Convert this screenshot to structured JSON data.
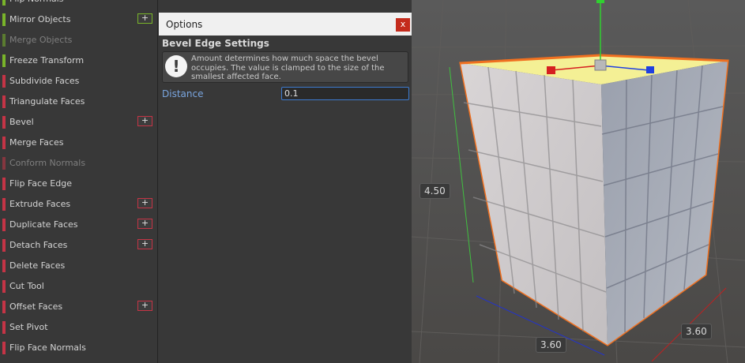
{
  "toolbar": {
    "items": [
      {
        "label": "Flip Normals",
        "color": "#79b42a",
        "has_plus": false,
        "disabled": false
      },
      {
        "label": "Mirror Objects",
        "color": "#79b42a",
        "has_plus": true,
        "disabled": false
      },
      {
        "label": "Merge Objects",
        "color": "#79b42a",
        "has_plus": false,
        "disabled": true
      },
      {
        "label": "Freeze Transform",
        "color": "#79b42a",
        "has_plus": false,
        "disabled": false
      },
      {
        "label": "Subdivide Faces",
        "color": "#c53446",
        "has_plus": false,
        "disabled": false
      },
      {
        "label": "Triangulate Faces",
        "color": "#c53446",
        "has_plus": false,
        "disabled": false
      },
      {
        "label": "Bevel",
        "color": "#c53446",
        "has_plus": true,
        "disabled": false
      },
      {
        "label": "Merge Faces",
        "color": "#c53446",
        "has_plus": false,
        "disabled": false
      },
      {
        "label": "Conform Normals",
        "color": "#c53446",
        "has_plus": false,
        "disabled": true
      },
      {
        "label": "Flip Face Edge",
        "color": "#c53446",
        "has_plus": false,
        "disabled": false
      },
      {
        "label": "Extrude Faces",
        "color": "#c53446",
        "has_plus": true,
        "disabled": false
      },
      {
        "label": "Duplicate Faces",
        "color": "#c53446",
        "has_plus": true,
        "disabled": false
      },
      {
        "label": "Detach Faces",
        "color": "#c53446",
        "has_plus": true,
        "disabled": false
      },
      {
        "label": "Delete Faces",
        "color": "#c53446",
        "has_plus": false,
        "disabled": false
      },
      {
        "label": "Cut Tool",
        "color": "#c53446",
        "has_plus": false,
        "disabled": false
      },
      {
        "label": "Offset Faces",
        "color": "#c53446",
        "has_plus": true,
        "disabled": false
      },
      {
        "label": "Set Pivot",
        "color": "#c53446",
        "has_plus": false,
        "disabled": false
      },
      {
        "label": "Flip Face Normals",
        "color": "#c53446",
        "has_plus": false,
        "disabled": false
      }
    ],
    "plus_glyph": "+"
  },
  "options": {
    "title": "Options",
    "close_glyph": "x",
    "section_title": "Bevel Edge Settings",
    "help_icon": "!",
    "help_text": "Amount determines how much space the bevel occupies. The value is clamped to the size of the smallest affected face.",
    "distance_label": "Distance",
    "distance_value": "0.1"
  },
  "scene": {
    "dim_height": "4.50",
    "dim_width_front": "3.60",
    "dim_width_side": "3.60",
    "colors": {
      "selection_outline": "#f07020",
      "top_face": "#f4f095",
      "axis_x": "#d62020",
      "axis_y": "#30d030",
      "axis_z": "#2040e0"
    }
  }
}
